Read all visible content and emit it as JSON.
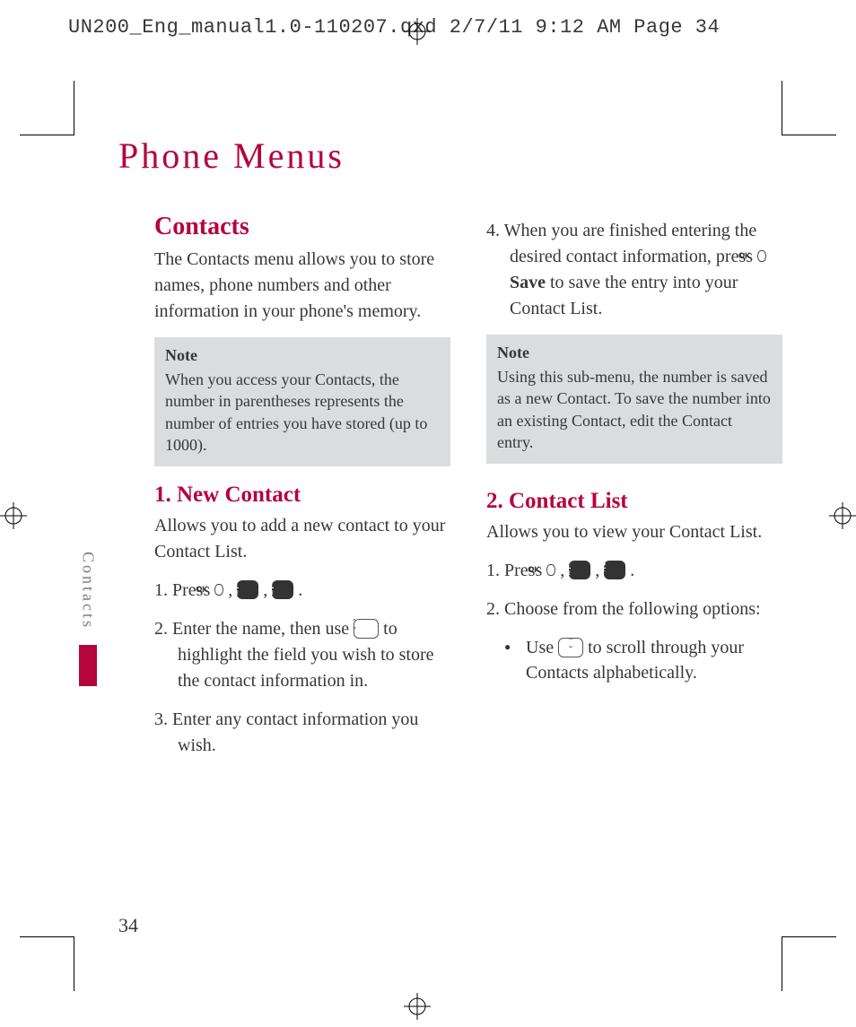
{
  "header": {
    "slug": "UN200_Eng_manual1.0-110207.qxd  2/7/11  9:12 AM  Page 34"
  },
  "page": {
    "title": "Phone Menus",
    "number": "34",
    "side_tab": "Contacts"
  },
  "left": {
    "h2": "Contacts",
    "intro": "The Contacts menu allows you to store names, phone numbers and other information in your phone's memory.",
    "note": {
      "title": "Note",
      "body": "When you access your Contacts, the number in parentheses represents the number of entries you have stored (up to 1000)."
    },
    "h3": "1. New Contact",
    "desc": "Allows you to add a new contact to your Contact List.",
    "steps": {
      "s1_prefix": "Press ",
      "s1_keys": [
        {
          "kind": "ok",
          "label": "OK"
        },
        {
          "kind": "num",
          "digit": "1",
          "letters": "R"
        },
        {
          "kind": "num",
          "digit": "1",
          "letters": "R"
        }
      ],
      "s2_a": "Enter the name, then use ",
      "s2_b": " to highlight the field you wish to store the contact information in.",
      "s3": "Enter any contact information you wish."
    }
  },
  "right": {
    "step4_a": "When you are finished entering the desired contact information, press ",
    "step4_save": "Save",
    "step4_b": " to save the entry into your Contact List.",
    "note": {
      "title": "Note",
      "body": "Using this sub-menu, the number is saved as a new Contact. To save the number into an existing Contact, edit the Contact entry."
    },
    "h3": "2. Contact List",
    "desc": "Allows you to view your Contact List.",
    "steps": {
      "s1_prefix": "Press ",
      "s1_keys": [
        {
          "kind": "ok",
          "label": "OK"
        },
        {
          "kind": "num",
          "digit": "1",
          "letters": "R"
        },
        {
          "kind": "num",
          "digit": "2",
          "letters": "T"
        }
      ],
      "s2": "Choose from the following options:"
    },
    "bullet_a": "Use ",
    "bullet_b": " to scroll through your Contacts alphabetically."
  }
}
